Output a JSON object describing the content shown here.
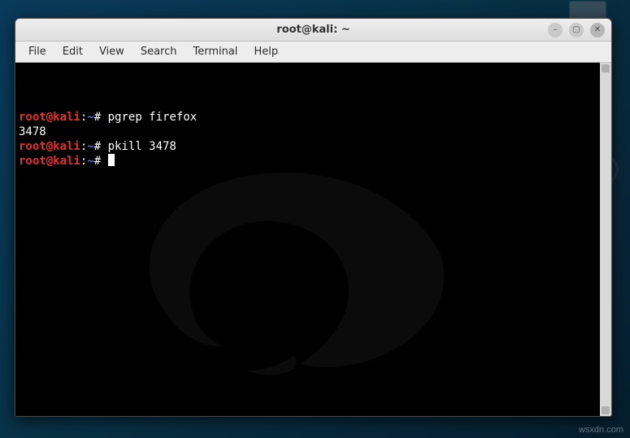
{
  "window": {
    "title": "root@kali: ~",
    "buttons": {
      "minimize_icon": "–",
      "maximize_icon": "▢",
      "close_icon": "✕"
    }
  },
  "menu": {
    "file": "File",
    "edit": "Edit",
    "view": "View",
    "search": "Search",
    "terminal": "Terminal",
    "help": "Help"
  },
  "prompt": {
    "userhost": "root@kali",
    "sep1": ":",
    "path": "~",
    "sep2": "#"
  },
  "terminal": {
    "lines": [
      {
        "type": "cmd",
        "text": " pgrep firefox"
      },
      {
        "type": "out",
        "text": "3478"
      },
      {
        "type": "cmd",
        "text": " pkill 3478"
      },
      {
        "type": "cmd",
        "text": " ",
        "cursor": true
      }
    ]
  },
  "watermark": "wsxdn.com"
}
